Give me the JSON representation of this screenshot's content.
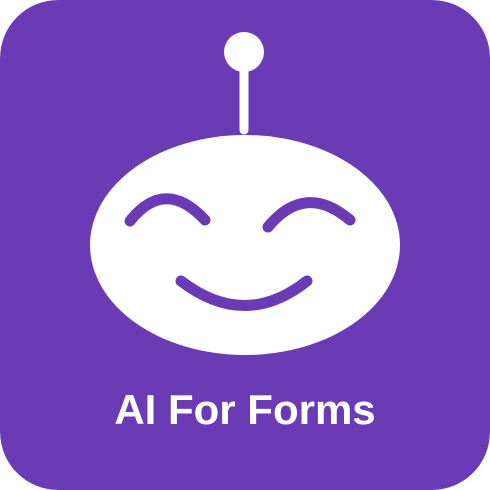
{
  "app": {
    "name": "AI For Forms"
  },
  "logo": {
    "icon": "smiling-robot-face-icon"
  },
  "colors": {
    "background": "#6a3bb5",
    "foreground": "#ffffff"
  }
}
